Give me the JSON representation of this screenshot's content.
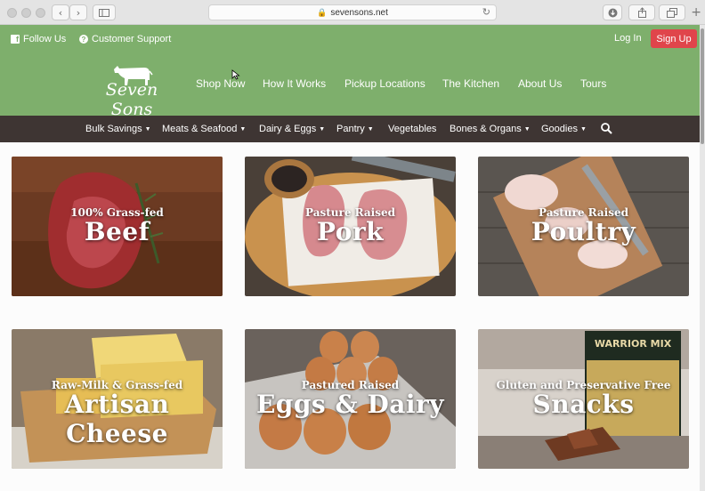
{
  "browser": {
    "url": "sevensons.net"
  },
  "header": {
    "follow_us": "Follow Us",
    "customer_support": "Customer Support",
    "login": "Log In",
    "signup": "Sign Up",
    "logo_text": "Seven Sons"
  },
  "main_nav": [
    "Shop Now",
    "How It Works",
    "Pickup Locations",
    "The Kitchen",
    "About Us",
    "Tours"
  ],
  "sub_nav": [
    "Bulk Savings",
    "Meats & Seafood",
    "Dairy & Eggs",
    "Pantry",
    "Vegetables",
    "Bones & Organs",
    "Goodies"
  ],
  "categories": [
    {
      "subtitle": "100% Grass-fed",
      "title": "Beef"
    },
    {
      "subtitle": "Pasture Raised",
      "title": "Pork"
    },
    {
      "subtitle": "Pasture Raised",
      "title": "Poultry"
    },
    {
      "subtitle": "Raw-Milk & Grass-fed",
      "title": "Artisan Cheese"
    },
    {
      "subtitle": "Pastured Raised",
      "title": "Eggs & Dairy"
    },
    {
      "subtitle": "Gluten and Preservative Free",
      "title": "Snacks"
    }
  ],
  "product_label": "WARRIOR MIX",
  "colors": {
    "header_green": "#7eaf6c",
    "subnav_dark": "#3e3533",
    "signup_red": "#e0454b"
  }
}
